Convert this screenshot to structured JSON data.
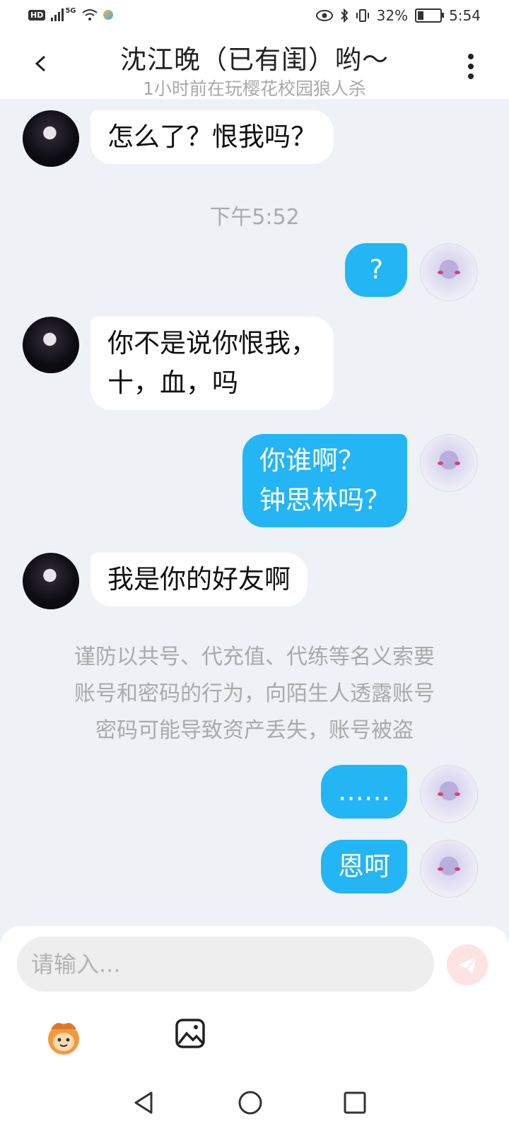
{
  "status_bar": {
    "network": "HD",
    "signal_label": "5G",
    "battery_percent": "32%",
    "battery_level": 0.32,
    "time": "5:54"
  },
  "header": {
    "title": "沈江晚（已有闺）哟～",
    "subtitle": "1小时前在玩樱花校园狼人杀"
  },
  "messages": [
    {
      "side": "other",
      "text": "怎么了？恨我吗？"
    },
    {
      "side": "time",
      "text": "下午5:52"
    },
    {
      "side": "me",
      "text": "?"
    },
    {
      "side": "other",
      "lines": [
        "你不是说你恨我，",
        "十，血，吗"
      ]
    },
    {
      "side": "me",
      "lines": [
        "你谁啊？",
        "钟思林吗？"
      ]
    },
    {
      "side": "other",
      "text": "我是你的好友啊"
    },
    {
      "side": "notice",
      "lines": [
        "谨防以共号、代充值、代练等名义索要",
        "账号和密码的行为，向陌生人透露账号",
        "密码可能导致资产丢失，账号被盗"
      ]
    },
    {
      "side": "me",
      "text": "……"
    },
    {
      "side": "me",
      "text": "恩呵"
    }
  ],
  "composer": {
    "placeholder": "请输入..."
  },
  "colors": {
    "my_bubble": "#23b5f4",
    "other_bubble": "#ffffff",
    "background": "#eef1f6",
    "send_button": "#fde3e1"
  },
  "icons": [
    "back-icon",
    "more-icon",
    "emoji-icon",
    "image-icon",
    "send-icon",
    "nav-back-icon",
    "nav-home-icon",
    "nav-recents-icon"
  ]
}
